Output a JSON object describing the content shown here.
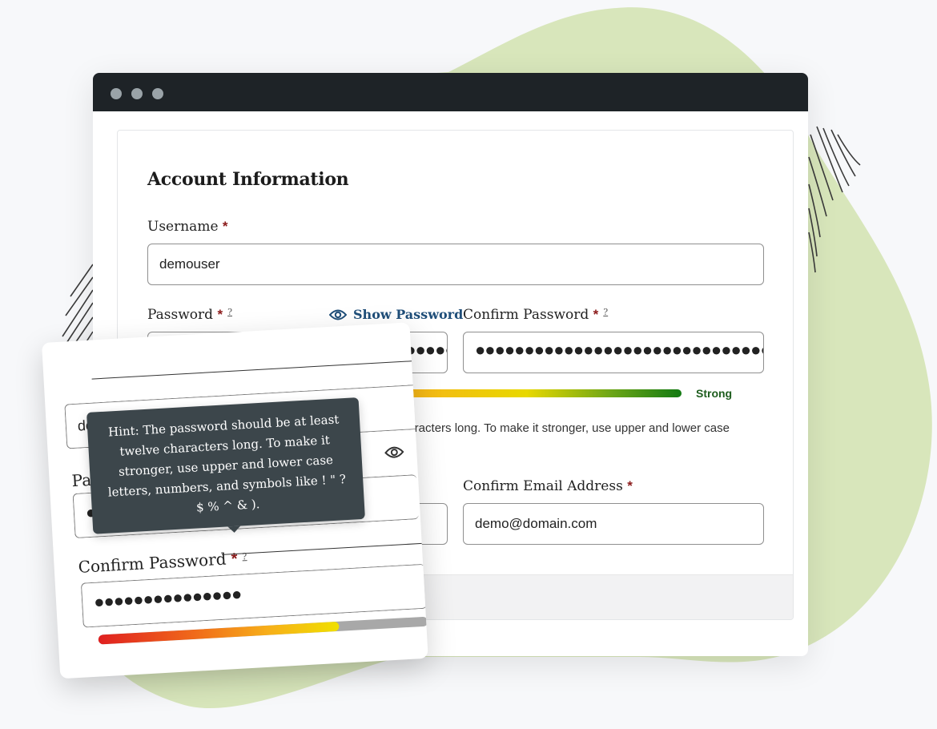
{
  "colors": {
    "titlebar": "#1e2327",
    "required": "#8b1a1a",
    "link": "#1f4e79",
    "blob": "#d8e6bb",
    "tooltip_bg": "#3c464b",
    "strong": "#1e5d1e"
  },
  "form": {
    "title": "Account Information",
    "username": {
      "label": "Username",
      "required_mark": "*",
      "value": "demouser"
    },
    "password": {
      "label": "Password",
      "required_mark": "*",
      "help_mark": "?",
      "value": "●●●●●●●●●●●●●●●●●●●●●●●●●●●●●●●●●●●●●●●"
    },
    "show_password": {
      "icon": "eye-icon",
      "label": "Show Password"
    },
    "confirm_password": {
      "label": "Confirm Password",
      "required_mark": "*",
      "help_mark": "?",
      "value": "●●●●●●●●●●●●●●●●●●●●●●●●●●●●●●●●●●●●●●●●●●●●●●●●"
    },
    "strength": {
      "label": "Strong",
      "level": 1.0
    },
    "hint_partial_1": "haracters long. To make it stronger, use upper and lower case",
    "hint_partial_2": ").",
    "confirm_email": {
      "label": "Confirm Email Address",
      "required_mark": "*",
      "value": "demo@domain.com"
    }
  },
  "zoom": {
    "username_value": "demouser",
    "password_label_partial": "Pas",
    "password_value_partial": "●●●",
    "confirm_password": {
      "label": "Confirm Password",
      "required_mark": "*",
      "help_mark": "?",
      "value": "●●●●●●●●●●●●●●●"
    },
    "strength_level": 0.73,
    "eye_icon": "eye-icon"
  },
  "tooltip": {
    "text": "Hint: The password should be at least twelve characters long. To make it stronger, use upper and lower case letters, numbers, and symbols like ! \" ? $ % ^ & )."
  }
}
